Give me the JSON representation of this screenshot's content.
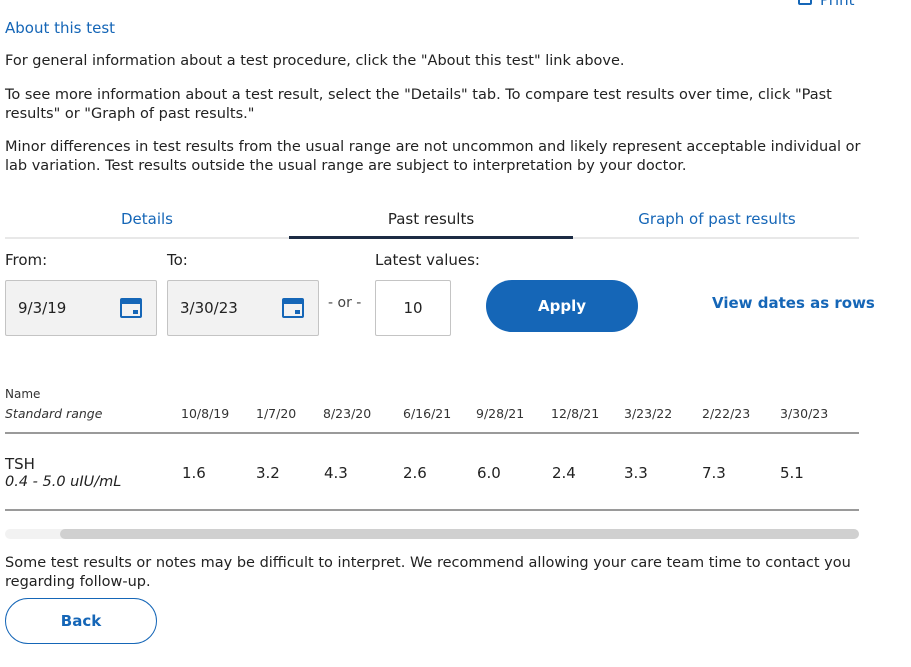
{
  "header": {
    "print_label": "Print",
    "about_link": "About this test"
  },
  "intro": {
    "p1": "For general information about a test procedure, click the \"About this test\" link above.",
    "p2": "To see more information about a test result, select the \"Details\" tab. To compare test results over time, click \"Past results\" or \"Graph of past results.\"",
    "p3": "Minor differences in test results from the usual range are not uncommon and likely represent acceptable individual or lab variation. Test results outside the usual range are subject to interpretation by your doctor."
  },
  "tabs": [
    {
      "label": "Details"
    },
    {
      "label": "Past results"
    },
    {
      "label": "Graph of past results"
    }
  ],
  "filters": {
    "from_label": "From:",
    "from_value": "9/3/19",
    "to_label": "To:",
    "to_value": "3/30/23",
    "or_text": "- or -",
    "latest_label": "Latest values:",
    "latest_value": "10",
    "apply_label": "Apply",
    "view_rows_label": "View dates as rows"
  },
  "table": {
    "name_header": "Name",
    "range_header": "Standard range",
    "dates": [
      "10/8/19",
      "1/7/20",
      "8/23/20",
      "6/16/21",
      "9/28/21",
      "12/8/21",
      "3/23/22",
      "2/22/23",
      "3/30/23"
    ],
    "rows": [
      {
        "name": "TSH",
        "range": "0.4 - 5.0 uIU/mL",
        "values": [
          "1.6",
          "3.2",
          "4.3",
          "2.6",
          "6.0",
          "2.4",
          "3.3",
          "7.3",
          "5.1"
        ]
      }
    ]
  },
  "footer": {
    "note": "Some test results or notes may be difficult to interpret. We recommend allowing your care team time to contact you regarding follow-up.",
    "back_label": "Back"
  },
  "colors": {
    "link": "#1566b7",
    "tab_active_underline": "#1c2b44"
  }
}
